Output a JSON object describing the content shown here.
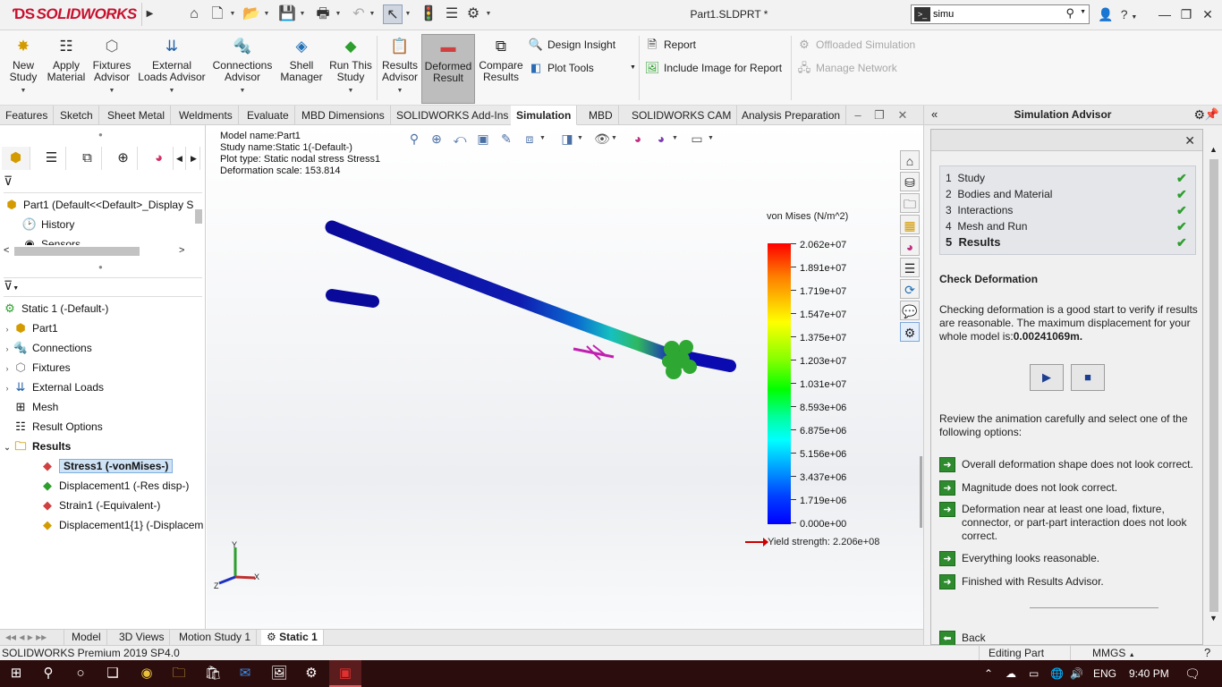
{
  "titlebar": {
    "brand": "SOLIDWORKS",
    "filename": "Part1.SLDPRT *",
    "search_value": "simu",
    "help_label": "?"
  },
  "ribbon": {
    "buttons": [
      {
        "label": "New Study"
      },
      {
        "label": "Apply Material"
      },
      {
        "label": "Fixtures Advisor"
      },
      {
        "label": "External Loads Advisor"
      },
      {
        "label": "Connections Advisor"
      },
      {
        "label": "Shell Manager"
      },
      {
        "label": "Run This Study"
      },
      {
        "label": "Results Advisor"
      },
      {
        "label": "Deformed Result"
      },
      {
        "label": "Compare Results"
      }
    ],
    "small": {
      "design_insight": "Design Insight",
      "plot_tools": "Plot Tools",
      "report": "Report",
      "include_image": "Include Image for Report",
      "offloaded": "Offloaded Simulation",
      "manage_network": "Manage Network"
    }
  },
  "tabs": [
    "Features",
    "Sketch",
    "Sheet Metal",
    "Weldments",
    "Evaluate",
    "MBD Dimensions",
    "SOLIDWORKS Add-Ins",
    "Simulation",
    "MBD",
    "SOLIDWORKS CAM",
    "Analysis Preparation"
  ],
  "active_tab": "Simulation",
  "feature_tree": {
    "part_label": "Part1  (Default<<Default>_Display S",
    "history": "History",
    "sensors": "Sensors"
  },
  "study_tree": {
    "root": "Static 1 (-Default-)",
    "items": [
      "Part1",
      "Connections",
      "Fixtures",
      "External Loads",
      "Mesh",
      "Result Options",
      "Results"
    ],
    "results": [
      "Stress1 (-vonMises-)",
      "Displacement1 (-Res disp-)",
      "Strain1 (-Equivalent-)",
      "Displacement1{1} (-Displacem"
    ]
  },
  "viewport": {
    "model_name": "Model name:Part1",
    "study_name": "Study name:Static 1(-Default-)",
    "plot_type": "Plot type: Static nodal stress Stress1",
    "deformation_scale": "Deformation scale: 153.814",
    "legend_title": "von Mises (N/m^2)",
    "legend_values": [
      "2.062e+07",
      "1.891e+07",
      "1.719e+07",
      "1.547e+07",
      "1.375e+07",
      "1.203e+07",
      "1.031e+07",
      "8.593e+06",
      "6.875e+06",
      "5.156e+06",
      "3.437e+06",
      "1.719e+06",
      "0.000e+00"
    ],
    "yield": "Yield strength: 2.206e+08",
    "axis_x": "X",
    "axis_y": "Y",
    "axis_z": "Z"
  },
  "bottom_tabs": [
    "Model",
    "3D Views",
    "Motion Study 1",
    "Static 1"
  ],
  "advisor": {
    "title": "Simulation Advisor",
    "steps": [
      {
        "num": "1",
        "label": "Study"
      },
      {
        "num": "2",
        "label": "Bodies and Material"
      },
      {
        "num": "3",
        "label": "Interactions"
      },
      {
        "num": "4",
        "label": "Mesh and Run"
      },
      {
        "num": "5",
        "label": "Results"
      }
    ],
    "heading": "Check Deformation",
    "paragraph": "Checking deformation is a good start to verify if results are reasonable. The maximum displacement for your whole model is:",
    "max_disp": "0.00241069m.",
    "review": "Review the animation carefully and select one of the following options:",
    "options": [
      "Overall deformation shape does not look correct.",
      "Magnitude does not look correct.",
      "Deformation near at least one load, fixture, connector, or part-part interaction does not look correct.",
      "Everything looks reasonable.",
      "Finished with Results Advisor."
    ],
    "back": "Back"
  },
  "statusbar": {
    "product": "SOLIDWORKS Premium 2019 SP4.0",
    "mode": "Editing Part",
    "units": "MMGS"
  },
  "taskbar": {
    "lang": "ENG",
    "time": "9:40 PM"
  },
  "colors": {
    "brand": "#c8102e",
    "check": "#2e9e2e",
    "taskbar": "#2c0d0d"
  }
}
